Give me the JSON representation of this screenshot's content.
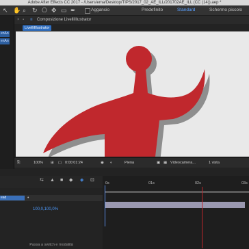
{
  "window": {
    "title": "Adobe After Effects CC 2017 - /Users/ema/Desktop/TIPS/2017_02_AE_ILL/201702AE_ILL (CC (14)).aep *"
  },
  "toolbar": {
    "snap_label": "Aggancio",
    "workspaces": [
      "Predefinito",
      "Standard",
      "Schermo piccolo"
    ],
    "active_workspace": "Standard"
  },
  "left_panel": {
    "items": [
      "enAn",
      "enAn"
    ]
  },
  "comp_header": {
    "label": "Composizione LivelliIllustrator"
  },
  "comp_tab": {
    "label": "LivelliIllustrator"
  },
  "viewer_bar": {
    "zoom": "100%",
    "timecode": "0:00:01:24",
    "resolution": "Piena",
    "camera": "Videocamera...",
    "views": "1 vista"
  },
  "timeline": {
    "ruler_ticks": [
      "0s",
      "01s",
      "02s",
      "03s"
    ],
    "layer_label": "ead",
    "scale_value": "100,0,100,0%",
    "footer": "Passa a switch e modalità"
  },
  "colors": {
    "figure_red": "#c0282d",
    "shadow": "#8e8e8e",
    "accent_blue": "#2f6ec0",
    "playhead": "#c0262b"
  }
}
